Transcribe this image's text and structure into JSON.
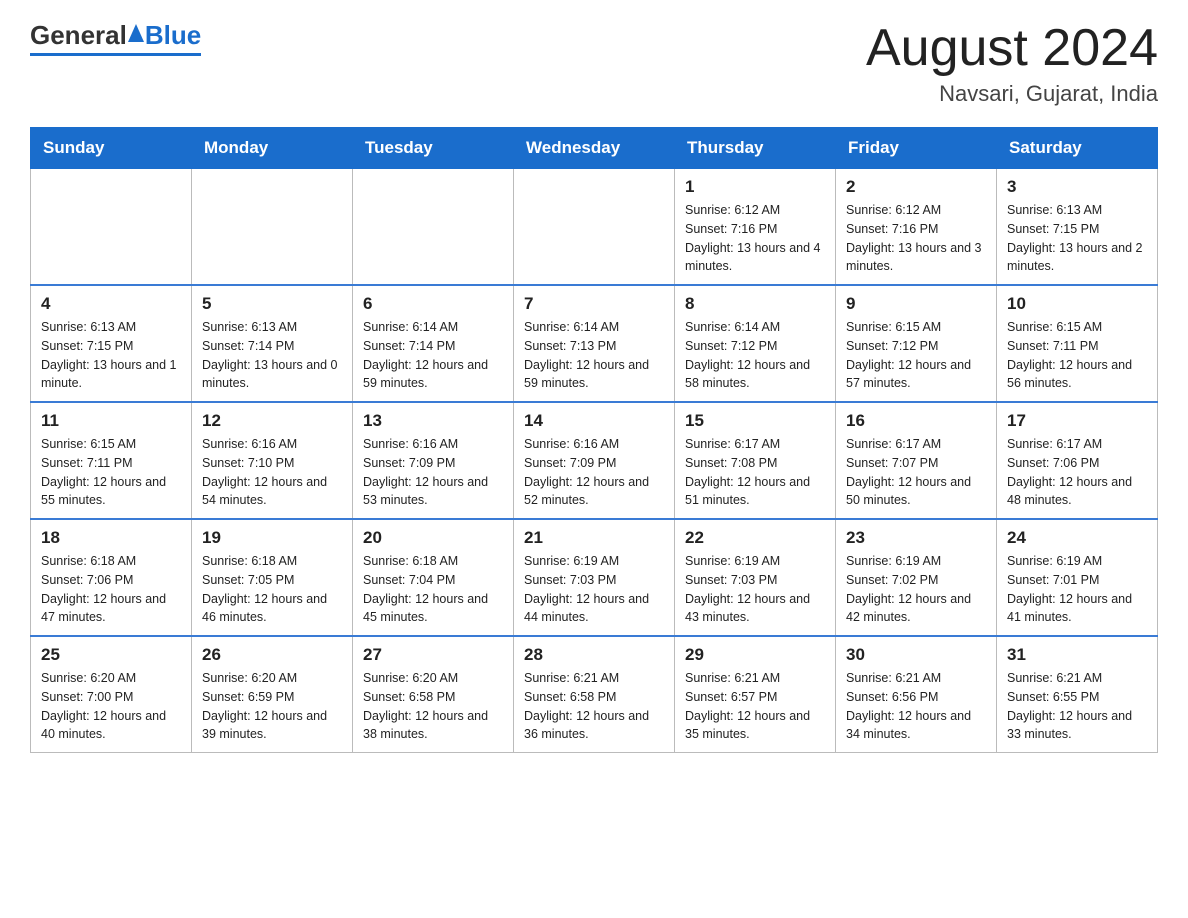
{
  "header": {
    "logo_general": "General",
    "logo_blue": "Blue",
    "month_title": "August 2024",
    "location": "Navsari, Gujarat, India"
  },
  "weekdays": [
    "Sunday",
    "Monday",
    "Tuesday",
    "Wednesday",
    "Thursday",
    "Friday",
    "Saturday"
  ],
  "weeks": [
    [
      {
        "day": "",
        "sunrise": "",
        "sunset": "",
        "daylight": ""
      },
      {
        "day": "",
        "sunrise": "",
        "sunset": "",
        "daylight": ""
      },
      {
        "day": "",
        "sunrise": "",
        "sunset": "",
        "daylight": ""
      },
      {
        "day": "",
        "sunrise": "",
        "sunset": "",
        "daylight": ""
      },
      {
        "day": "1",
        "sunrise": "Sunrise: 6:12 AM",
        "sunset": "Sunset: 7:16 PM",
        "daylight": "Daylight: 13 hours and 4 minutes."
      },
      {
        "day": "2",
        "sunrise": "Sunrise: 6:12 AM",
        "sunset": "Sunset: 7:16 PM",
        "daylight": "Daylight: 13 hours and 3 minutes."
      },
      {
        "day": "3",
        "sunrise": "Sunrise: 6:13 AM",
        "sunset": "Sunset: 7:15 PM",
        "daylight": "Daylight: 13 hours and 2 minutes."
      }
    ],
    [
      {
        "day": "4",
        "sunrise": "Sunrise: 6:13 AM",
        "sunset": "Sunset: 7:15 PM",
        "daylight": "Daylight: 13 hours and 1 minute."
      },
      {
        "day": "5",
        "sunrise": "Sunrise: 6:13 AM",
        "sunset": "Sunset: 7:14 PM",
        "daylight": "Daylight: 13 hours and 0 minutes."
      },
      {
        "day": "6",
        "sunrise": "Sunrise: 6:14 AM",
        "sunset": "Sunset: 7:14 PM",
        "daylight": "Daylight: 12 hours and 59 minutes."
      },
      {
        "day": "7",
        "sunrise": "Sunrise: 6:14 AM",
        "sunset": "Sunset: 7:13 PM",
        "daylight": "Daylight: 12 hours and 59 minutes."
      },
      {
        "day": "8",
        "sunrise": "Sunrise: 6:14 AM",
        "sunset": "Sunset: 7:12 PM",
        "daylight": "Daylight: 12 hours and 58 minutes."
      },
      {
        "day": "9",
        "sunrise": "Sunrise: 6:15 AM",
        "sunset": "Sunset: 7:12 PM",
        "daylight": "Daylight: 12 hours and 57 minutes."
      },
      {
        "day": "10",
        "sunrise": "Sunrise: 6:15 AM",
        "sunset": "Sunset: 7:11 PM",
        "daylight": "Daylight: 12 hours and 56 minutes."
      }
    ],
    [
      {
        "day": "11",
        "sunrise": "Sunrise: 6:15 AM",
        "sunset": "Sunset: 7:11 PM",
        "daylight": "Daylight: 12 hours and 55 minutes."
      },
      {
        "day": "12",
        "sunrise": "Sunrise: 6:16 AM",
        "sunset": "Sunset: 7:10 PM",
        "daylight": "Daylight: 12 hours and 54 minutes."
      },
      {
        "day": "13",
        "sunrise": "Sunrise: 6:16 AM",
        "sunset": "Sunset: 7:09 PM",
        "daylight": "Daylight: 12 hours and 53 minutes."
      },
      {
        "day": "14",
        "sunrise": "Sunrise: 6:16 AM",
        "sunset": "Sunset: 7:09 PM",
        "daylight": "Daylight: 12 hours and 52 minutes."
      },
      {
        "day": "15",
        "sunrise": "Sunrise: 6:17 AM",
        "sunset": "Sunset: 7:08 PM",
        "daylight": "Daylight: 12 hours and 51 minutes."
      },
      {
        "day": "16",
        "sunrise": "Sunrise: 6:17 AM",
        "sunset": "Sunset: 7:07 PM",
        "daylight": "Daylight: 12 hours and 50 minutes."
      },
      {
        "day": "17",
        "sunrise": "Sunrise: 6:17 AM",
        "sunset": "Sunset: 7:06 PM",
        "daylight": "Daylight: 12 hours and 48 minutes."
      }
    ],
    [
      {
        "day": "18",
        "sunrise": "Sunrise: 6:18 AM",
        "sunset": "Sunset: 7:06 PM",
        "daylight": "Daylight: 12 hours and 47 minutes."
      },
      {
        "day": "19",
        "sunrise": "Sunrise: 6:18 AM",
        "sunset": "Sunset: 7:05 PM",
        "daylight": "Daylight: 12 hours and 46 minutes."
      },
      {
        "day": "20",
        "sunrise": "Sunrise: 6:18 AM",
        "sunset": "Sunset: 7:04 PM",
        "daylight": "Daylight: 12 hours and 45 minutes."
      },
      {
        "day": "21",
        "sunrise": "Sunrise: 6:19 AM",
        "sunset": "Sunset: 7:03 PM",
        "daylight": "Daylight: 12 hours and 44 minutes."
      },
      {
        "day": "22",
        "sunrise": "Sunrise: 6:19 AM",
        "sunset": "Sunset: 7:03 PM",
        "daylight": "Daylight: 12 hours and 43 minutes."
      },
      {
        "day": "23",
        "sunrise": "Sunrise: 6:19 AM",
        "sunset": "Sunset: 7:02 PM",
        "daylight": "Daylight: 12 hours and 42 minutes."
      },
      {
        "day": "24",
        "sunrise": "Sunrise: 6:19 AM",
        "sunset": "Sunset: 7:01 PM",
        "daylight": "Daylight: 12 hours and 41 minutes."
      }
    ],
    [
      {
        "day": "25",
        "sunrise": "Sunrise: 6:20 AM",
        "sunset": "Sunset: 7:00 PM",
        "daylight": "Daylight: 12 hours and 40 minutes."
      },
      {
        "day": "26",
        "sunrise": "Sunrise: 6:20 AM",
        "sunset": "Sunset: 6:59 PM",
        "daylight": "Daylight: 12 hours and 39 minutes."
      },
      {
        "day": "27",
        "sunrise": "Sunrise: 6:20 AM",
        "sunset": "Sunset: 6:58 PM",
        "daylight": "Daylight: 12 hours and 38 minutes."
      },
      {
        "day": "28",
        "sunrise": "Sunrise: 6:21 AM",
        "sunset": "Sunset: 6:58 PM",
        "daylight": "Daylight: 12 hours and 36 minutes."
      },
      {
        "day": "29",
        "sunrise": "Sunrise: 6:21 AM",
        "sunset": "Sunset: 6:57 PM",
        "daylight": "Daylight: 12 hours and 35 minutes."
      },
      {
        "day": "30",
        "sunrise": "Sunrise: 6:21 AM",
        "sunset": "Sunset: 6:56 PM",
        "daylight": "Daylight: 12 hours and 34 minutes."
      },
      {
        "day": "31",
        "sunrise": "Sunrise: 6:21 AM",
        "sunset": "Sunset: 6:55 PM",
        "daylight": "Daylight: 12 hours and 33 minutes."
      }
    ]
  ]
}
